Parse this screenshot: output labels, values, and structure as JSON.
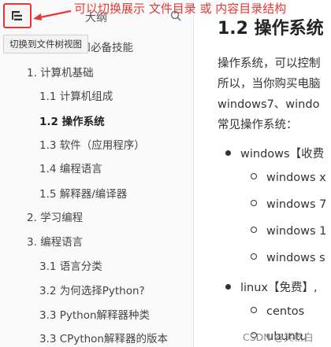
{
  "sidebar": {
    "toggle_tooltip": "切换到文件树视图",
    "outline_title": "大纲",
    "toc": [
      {
        "label": "础和必备技能",
        "active": false
      },
      {
        "label": "1. 计算机基础",
        "active": false
      },
      {
        "label": "1.1 计算机组成",
        "active": false
      },
      {
        "label": "1.2 操作系统",
        "active": true
      },
      {
        "label": "1.3 软件（应用程序）",
        "active": false
      },
      {
        "label": "1.4 编程语言",
        "active": false
      },
      {
        "label": "1.5 解释器/编译器",
        "active": false
      },
      {
        "label": "2. 学习编程",
        "active": false
      },
      {
        "label": "3. 编程语言",
        "active": false
      },
      {
        "label": "3.1 语言分类",
        "active": false
      },
      {
        "label": "3.2 为何选择Python?",
        "active": false
      },
      {
        "label": "3.3 Python解释器种类",
        "active": false
      },
      {
        "label": "3.3 CPython解释器的版本",
        "active": false
      }
    ]
  },
  "annotation": {
    "text": "可以切换展示 文件目录 或 内容目录结构"
  },
  "content": {
    "title": "1.2 操作系统",
    "paragraph_lines": [
      "操作系统，可以控制",
      "所以，当你购买电脑",
      "windows7、windo",
      "常见操作系统："
    ],
    "bullets": [
      {
        "level": 1,
        "text": "windows【收费"
      },
      {
        "level": 2,
        "text": "windows x"
      },
      {
        "level": 2,
        "text": "windows 7"
      },
      {
        "level": 2,
        "text": "windows 1"
      },
      {
        "level": 2,
        "text": "windows s"
      },
      {
        "level": 1,
        "text": "linux【免费】,"
      },
      {
        "level": 2,
        "text": "centos"
      },
      {
        "level": 2,
        "text": "ubuntu"
      }
    ]
  },
  "watermark": "CSDN @笑秋白"
}
